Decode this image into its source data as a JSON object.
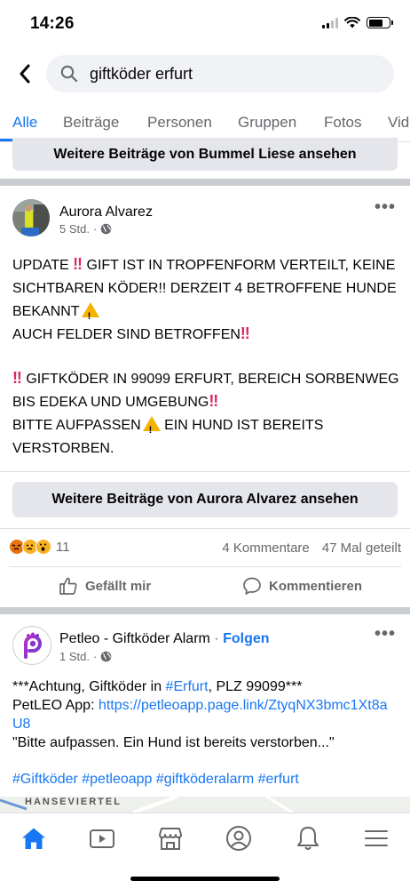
{
  "status_bar": {
    "time": "14:26",
    "battery_level": 0.7
  },
  "search": {
    "query": "giftköder erfurt"
  },
  "tabs": [
    "Alle",
    "Beiträge",
    "Personen",
    "Gruppen",
    "Fotos",
    "Vid"
  ],
  "active_tab": "Alle",
  "top_more_button": "Weitere Beiträge von Bummel Liese ansehen",
  "post1": {
    "author": "Aurora Alvarez",
    "time": "5 Std.",
    "dot": "·",
    "text": {
      "p1_a": "UPDATE",
      "p1_b": "GIFT IST IN TROPFENFORM VERTEILT, KEINE SICHTBAREN KÖDER!! DERZEIT 4 BETROFFENE HUNDE BEKANNT",
      "p2": "AUCH FELDER SIND BETROFFEN",
      "p3_a": "GIFTKÖDER IN 99099 ERFURT, BEREICH SORBENWEG BIS EDEKA UND UMGEBUNG",
      "p4_a": "BITTE AUFPASSEN",
      "p4_b": "EIN HUND IST BEREITS VERSTORBEN."
    },
    "emoji_bang": "‼",
    "more_button": "Weitere Beiträge von Aurora Alvarez ansehen",
    "reaction_count": "11",
    "comments": "4 Kommentare",
    "shares": "47 Mal geteilt",
    "like_label": "Gefällt mir",
    "comment_label": "Kommentieren"
  },
  "post2": {
    "author": "Petleo - Giftköder Alarm",
    "dot": "·",
    "follow": "Folgen",
    "time": "1 Std.",
    "line1_a": "***Achtung, Giftköder in ",
    "line1_link": "#Erfurt",
    "line1_b": ", PLZ 99099***",
    "line2_a": "PetLEO App: ",
    "line2_link": "https://petleoapp.page.link/ZtyqNX3bmc1Xt8aU8",
    "line3": "\"Bitte aufpassen. Ein Hund ist bereits verstorben...\"",
    "hashtags": "#Giftköder #petleoapp #giftköderalarm #erfurt",
    "map_label": "HANSEVIERTEL"
  },
  "colors": {
    "accent": "#1877f2",
    "meta": "#65676b",
    "separator": "#c9ccd1"
  }
}
